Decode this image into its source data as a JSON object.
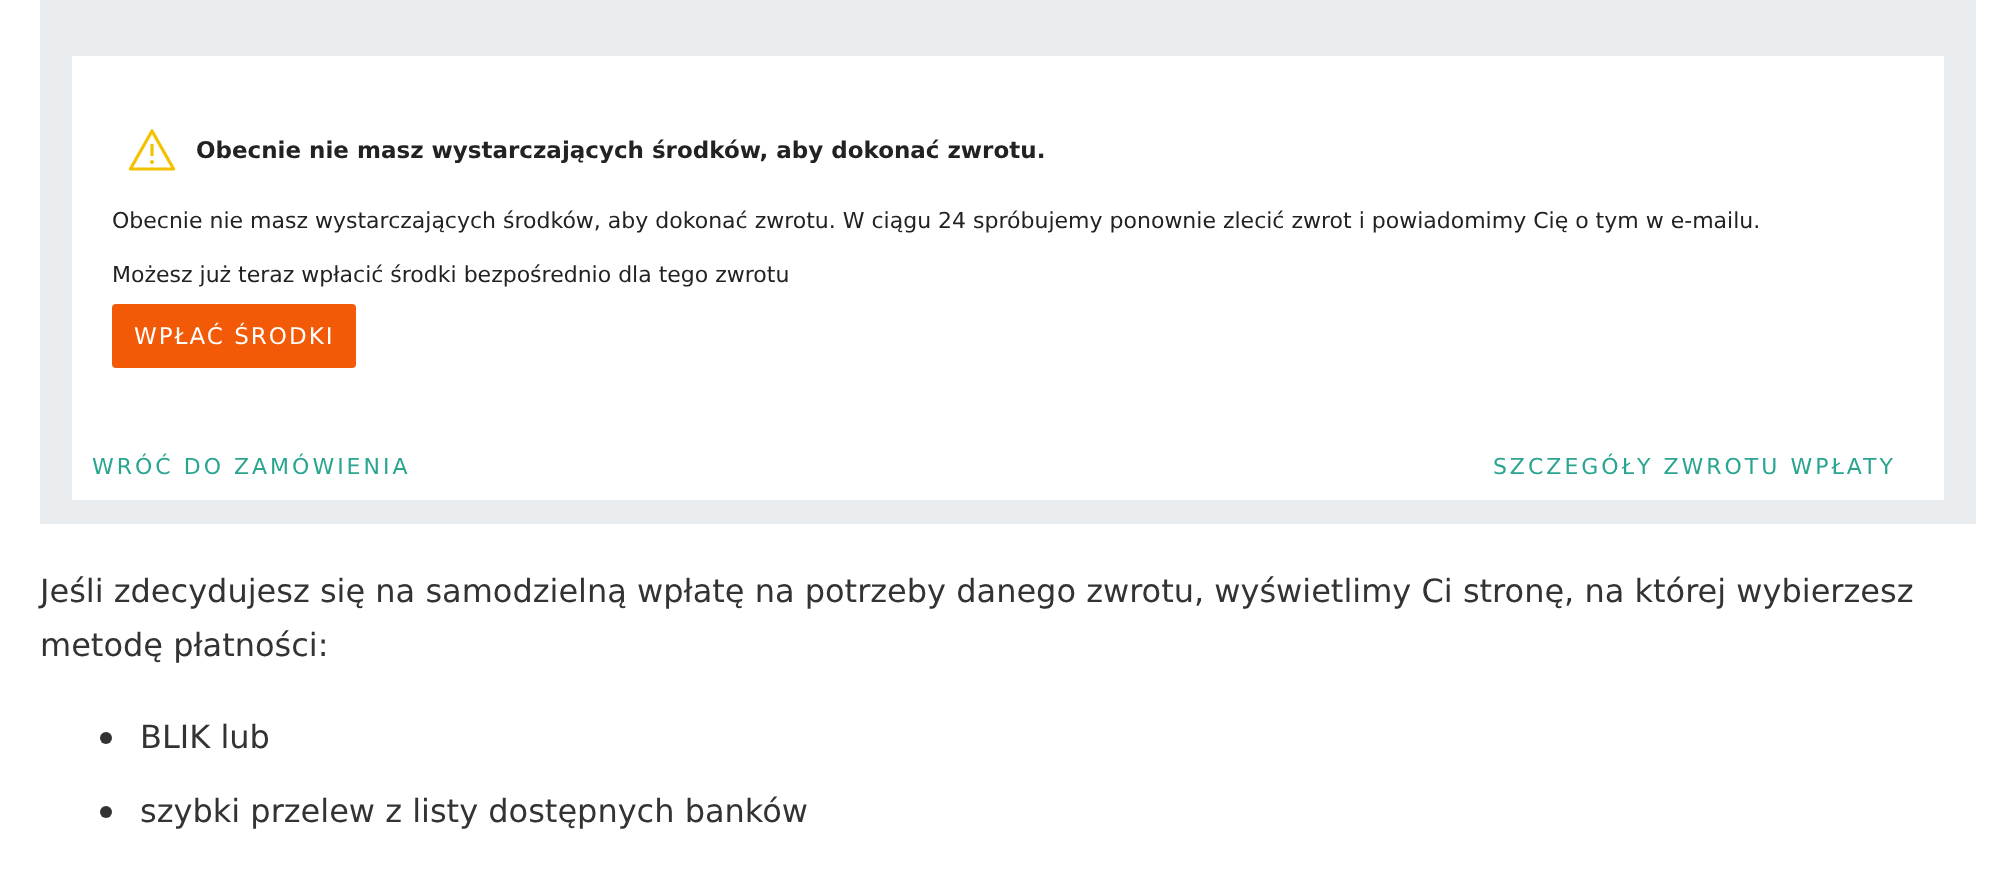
{
  "notice": {
    "heading": "Obecnie nie masz wystarczających środków, aby dokonać zwrotu.",
    "message": "Obecnie nie masz wystarczających środków, aby dokonać zwrotu. W ciągu 24 spróbujemy ponownie zlecić zwrot i powiadomimy Cię o tym w e-mailu.",
    "hint": "Możesz już teraz wpłacić środki bezpośrednio dla tego zwrotu",
    "button": "WPŁAĆ ŚRODKI",
    "links": [
      "WRÓĆ DO ZAMÓWIENIA",
      "SZCZEGÓŁY ZWROTU WPŁATY"
    ]
  },
  "article": {
    "paragraph": "Jeśli zdecydujesz się na samodzielną wpłatę na potrzeby danego zwrotu, wyświetlimy Ci stronę, na której wybierzesz metodę płatności:",
    "list": [
      "BLIK lub",
      "szybki przelew z listy dostępnych banków"
    ]
  }
}
